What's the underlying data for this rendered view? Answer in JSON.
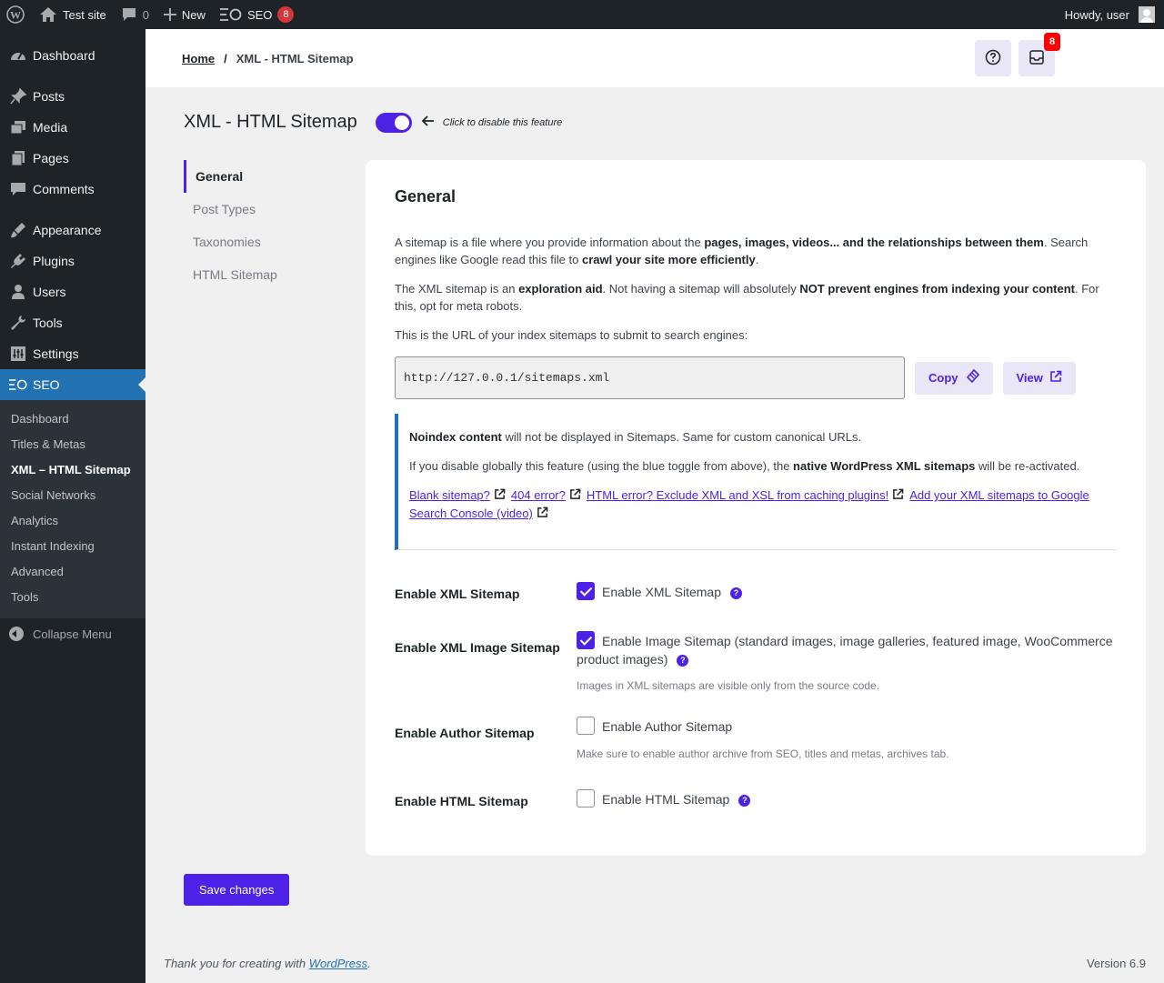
{
  "admin_bar": {
    "site_name": "Test site",
    "comments_count": "0",
    "new_label": "New",
    "seo_label": "SEO",
    "seo_badge": "8",
    "howdy": "Howdy, user"
  },
  "sidebar": {
    "items": [
      {
        "label": "Dashboard",
        "icon": "dashboard-icon"
      },
      {
        "label": "Posts",
        "icon": "pushpin-icon"
      },
      {
        "label": "Media",
        "icon": "media-icon"
      },
      {
        "label": "Pages",
        "icon": "pages-icon"
      },
      {
        "label": "Comments",
        "icon": "comments-icon"
      },
      {
        "label": "Appearance",
        "icon": "appearance-icon"
      },
      {
        "label": "Plugins",
        "icon": "plugins-icon"
      },
      {
        "label": "Users",
        "icon": "users-icon"
      },
      {
        "label": "Tools",
        "icon": "tools-icon"
      },
      {
        "label": "Settings",
        "icon": "settings-icon"
      },
      {
        "label": "SEO",
        "icon": "seo-icon"
      }
    ],
    "submenu": [
      "Dashboard",
      "Titles & Metas",
      "XML – HTML Sitemap",
      "Social Networks",
      "Analytics",
      "Instant Indexing",
      "Advanced",
      "Tools"
    ],
    "collapse_label": "Collapse Menu"
  },
  "breadcrumb": {
    "home": "Home",
    "separator": "/",
    "current": "XML - HTML Sitemap"
  },
  "notifications_badge": "8",
  "page": {
    "title": "XML - HTML Sitemap",
    "toggle_hint": "Click to disable this feature",
    "toggle_enabled": true
  },
  "subnav": [
    "General",
    "Post Types",
    "Taxonomies",
    "HTML Sitemap"
  ],
  "panel": {
    "heading": "General",
    "p1_a": "A sitemap is a file where you provide information about the ",
    "p1_b": "pages, images, videos... and the relationships between them",
    "p1_c": ". Search engines like Google read this file to ",
    "p1_d": "crawl your site more efficiently",
    "p1_e": ".",
    "p2_a": "The XML sitemap is an ",
    "p2_b": "exploration aid",
    "p2_c": ". Not having a sitemap will absolutely ",
    "p2_d": "NOT prevent engines from indexing your content",
    "p2_e": ". For this, opt for meta robots.",
    "p3": "This is the URL of your index sitemaps to submit to search engines:",
    "sitemap_url": "http://127.0.0.1/sitemaps.xml",
    "copy_label": "Copy",
    "view_label": "View",
    "notice_a": "Noindex content",
    "notice_b": " will not be displayed in Sitemaps. Same for custom canonical URLs.",
    "notice_c": "If you disable globally this feature (using the blue toggle from above), the ",
    "notice_d": "native WordPress XML sitemaps",
    "notice_e": " will be re-activated.",
    "links": [
      "Blank sitemap?",
      "404 error?",
      "HTML error? Exclude XML and XSL from caching plugins!",
      "Add your XML sitemaps to Google Search Console (video)"
    ]
  },
  "options": [
    {
      "label": "Enable XML Sitemap",
      "checkbox_label": "Enable XML Sitemap",
      "checked": true,
      "help": true,
      "description": ""
    },
    {
      "label": "Enable XML Image Sitemap",
      "checkbox_label": "Enable Image Sitemap (standard images, image galleries, featured image, WooCommerce product images)",
      "checked": true,
      "help": true,
      "description": "Images in XML sitemaps are visible only from the source code."
    },
    {
      "label": "Enable Author Sitemap",
      "checkbox_label": "Enable Author Sitemap",
      "checked": false,
      "help": false,
      "description": "Make sure to enable author archive from SEO, titles and metas, archives tab."
    },
    {
      "label": "Enable HTML Sitemap",
      "checkbox_label": "Enable HTML Sitemap",
      "checked": false,
      "help": true,
      "description": ""
    }
  ],
  "save_label": "Save changes",
  "footer": {
    "thanks_a": "Thank you for creating with ",
    "thanks_link": "WordPress",
    "thanks_b": ".",
    "version": "Version 6.9"
  },
  "colors": {
    "accent": "#4e21e7",
    "wp_blue": "#2271b1",
    "admin_dark": "#1d2327",
    "badge_red": "#d63638"
  }
}
